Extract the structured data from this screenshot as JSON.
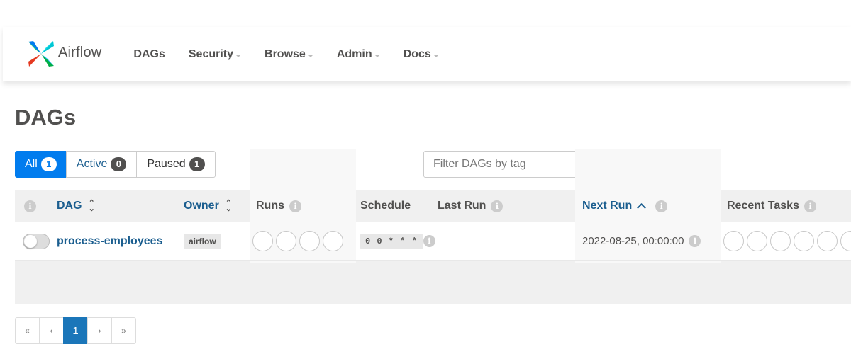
{
  "navbar": {
    "brand": "Airflow",
    "items": [
      {
        "label": "DAGs",
        "dropdown": false
      },
      {
        "label": "Security",
        "dropdown": true
      },
      {
        "label": "Browse",
        "dropdown": true
      },
      {
        "label": "Admin",
        "dropdown": true
      },
      {
        "label": "Docs",
        "dropdown": true
      }
    ]
  },
  "page_title": "DAGs",
  "status_filter": {
    "all": {
      "label": "All",
      "count": "1"
    },
    "active": {
      "label": "Active",
      "count": "0"
    },
    "paused": {
      "label": "Paused",
      "count": "1"
    }
  },
  "tag_filter": {
    "placeholder": "Filter DAGs by tag",
    "value": ""
  },
  "table": {
    "headers": {
      "info": "i",
      "dag": "DAG",
      "owner": "Owner",
      "runs": "Runs",
      "schedule": "Schedule",
      "last_run": "Last Run",
      "next_run": "Next Run",
      "recent_tasks": "Recent Tasks"
    },
    "rows": [
      {
        "paused": true,
        "dag_id": "process-employees",
        "owner": "airflow",
        "schedule": "0 0 * * *",
        "last_run": "",
        "next_run": "2022-08-25, 00:00:00"
      }
    ]
  },
  "pagination": {
    "first": "«",
    "prev": "‹",
    "current": "1",
    "next": "›",
    "last": "»"
  },
  "colors": {
    "primary": "#017cee",
    "link": "#1b5e8f",
    "header_bg": "#f0f0f0",
    "text": "#51504f"
  }
}
